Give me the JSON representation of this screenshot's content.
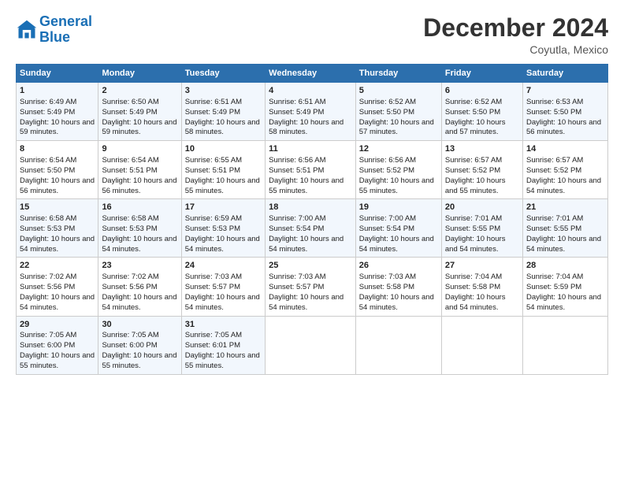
{
  "logo": {
    "line1": "General",
    "line2": "Blue"
  },
  "header": {
    "title": "December 2024",
    "subtitle": "Coyutla, Mexico"
  },
  "columns": [
    "Sunday",
    "Monday",
    "Tuesday",
    "Wednesday",
    "Thursday",
    "Friday",
    "Saturday"
  ],
  "weeks": [
    [
      {
        "day": "1",
        "sunrise": "6:49 AM",
        "sunset": "5:49 PM",
        "daylight": "10 hours and 59 minutes."
      },
      {
        "day": "2",
        "sunrise": "6:50 AM",
        "sunset": "5:49 PM",
        "daylight": "10 hours and 59 minutes."
      },
      {
        "day": "3",
        "sunrise": "6:51 AM",
        "sunset": "5:49 PM",
        "daylight": "10 hours and 58 minutes."
      },
      {
        "day": "4",
        "sunrise": "6:51 AM",
        "sunset": "5:49 PM",
        "daylight": "10 hours and 58 minutes."
      },
      {
        "day": "5",
        "sunrise": "6:52 AM",
        "sunset": "5:50 PM",
        "daylight": "10 hours and 57 minutes."
      },
      {
        "day": "6",
        "sunrise": "6:52 AM",
        "sunset": "5:50 PM",
        "daylight": "10 hours and 57 minutes."
      },
      {
        "day": "7",
        "sunrise": "6:53 AM",
        "sunset": "5:50 PM",
        "daylight": "10 hours and 56 minutes."
      }
    ],
    [
      {
        "day": "8",
        "sunrise": "6:54 AM",
        "sunset": "5:50 PM",
        "daylight": "10 hours and 56 minutes."
      },
      {
        "day": "9",
        "sunrise": "6:54 AM",
        "sunset": "5:51 PM",
        "daylight": "10 hours and 56 minutes."
      },
      {
        "day": "10",
        "sunrise": "6:55 AM",
        "sunset": "5:51 PM",
        "daylight": "10 hours and 55 minutes."
      },
      {
        "day": "11",
        "sunrise": "6:56 AM",
        "sunset": "5:51 PM",
        "daylight": "10 hours and 55 minutes."
      },
      {
        "day": "12",
        "sunrise": "6:56 AM",
        "sunset": "5:52 PM",
        "daylight": "10 hours and 55 minutes."
      },
      {
        "day": "13",
        "sunrise": "6:57 AM",
        "sunset": "5:52 PM",
        "daylight": "10 hours and 55 minutes."
      },
      {
        "day": "14",
        "sunrise": "6:57 AM",
        "sunset": "5:52 PM",
        "daylight": "10 hours and 54 minutes."
      }
    ],
    [
      {
        "day": "15",
        "sunrise": "6:58 AM",
        "sunset": "5:53 PM",
        "daylight": "10 hours and 54 minutes."
      },
      {
        "day": "16",
        "sunrise": "6:58 AM",
        "sunset": "5:53 PM",
        "daylight": "10 hours and 54 minutes."
      },
      {
        "day": "17",
        "sunrise": "6:59 AM",
        "sunset": "5:53 PM",
        "daylight": "10 hours and 54 minutes."
      },
      {
        "day": "18",
        "sunrise": "7:00 AM",
        "sunset": "5:54 PM",
        "daylight": "10 hours and 54 minutes."
      },
      {
        "day": "19",
        "sunrise": "7:00 AM",
        "sunset": "5:54 PM",
        "daylight": "10 hours and 54 minutes."
      },
      {
        "day": "20",
        "sunrise": "7:01 AM",
        "sunset": "5:55 PM",
        "daylight": "10 hours and 54 minutes."
      },
      {
        "day": "21",
        "sunrise": "7:01 AM",
        "sunset": "5:55 PM",
        "daylight": "10 hours and 54 minutes."
      }
    ],
    [
      {
        "day": "22",
        "sunrise": "7:02 AM",
        "sunset": "5:56 PM",
        "daylight": "10 hours and 54 minutes."
      },
      {
        "day": "23",
        "sunrise": "7:02 AM",
        "sunset": "5:56 PM",
        "daylight": "10 hours and 54 minutes."
      },
      {
        "day": "24",
        "sunrise": "7:03 AM",
        "sunset": "5:57 PM",
        "daylight": "10 hours and 54 minutes."
      },
      {
        "day": "25",
        "sunrise": "7:03 AM",
        "sunset": "5:57 PM",
        "daylight": "10 hours and 54 minutes."
      },
      {
        "day": "26",
        "sunrise": "7:03 AM",
        "sunset": "5:58 PM",
        "daylight": "10 hours and 54 minutes."
      },
      {
        "day": "27",
        "sunrise": "7:04 AM",
        "sunset": "5:58 PM",
        "daylight": "10 hours and 54 minutes."
      },
      {
        "day": "28",
        "sunrise": "7:04 AM",
        "sunset": "5:59 PM",
        "daylight": "10 hours and 54 minutes."
      }
    ],
    [
      {
        "day": "29",
        "sunrise": "7:05 AM",
        "sunset": "6:00 PM",
        "daylight": "10 hours and 55 minutes."
      },
      {
        "day": "30",
        "sunrise": "7:05 AM",
        "sunset": "6:00 PM",
        "daylight": "10 hours and 55 minutes."
      },
      {
        "day": "31",
        "sunrise": "7:05 AM",
        "sunset": "6:01 PM",
        "daylight": "10 hours and 55 minutes."
      },
      null,
      null,
      null,
      null
    ]
  ],
  "labels": {
    "sunrise": "Sunrise:",
    "sunset": "Sunset:",
    "daylight": "Daylight:"
  }
}
